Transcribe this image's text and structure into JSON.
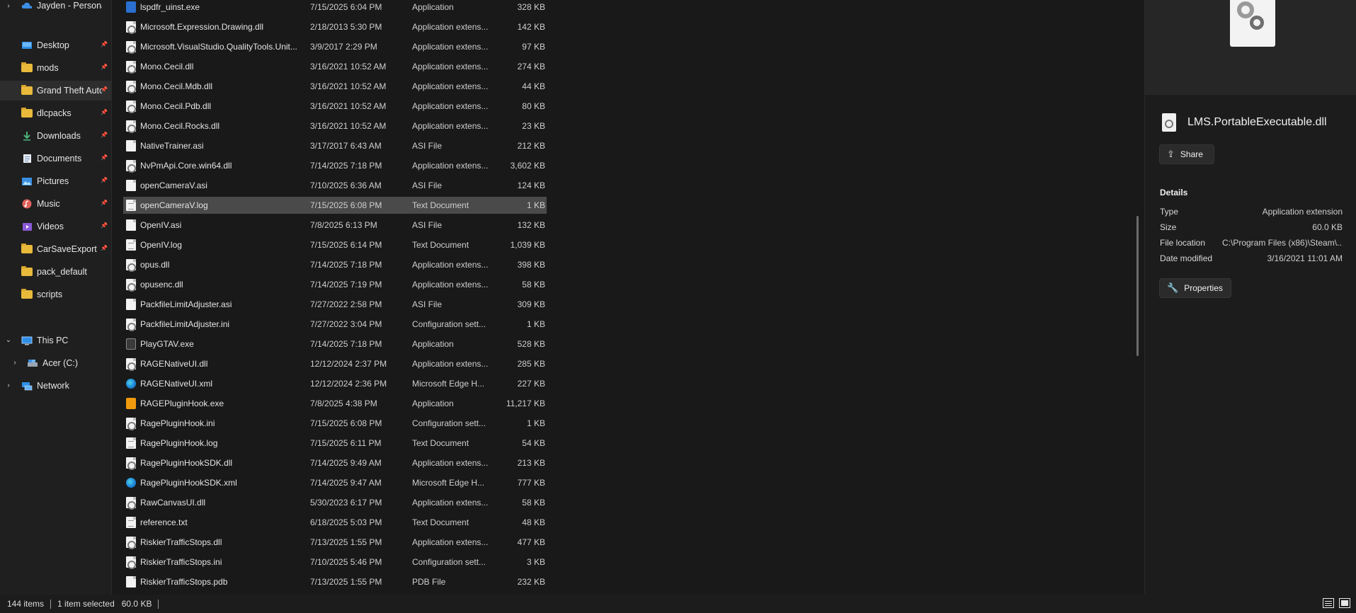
{
  "sidebar": {
    "top_partial": "Jayden - Personal",
    "quick_access": [
      {
        "label": "Desktop",
        "icon": "desktop-icon",
        "pinned": true
      },
      {
        "label": "mods",
        "icon": "folder-icon",
        "pinned": true
      },
      {
        "label": "Grand Theft Auto V",
        "icon": "folder-icon",
        "pinned": true,
        "selected": true
      },
      {
        "label": "dlcpacks",
        "icon": "folder-icon",
        "pinned": true
      },
      {
        "label": "Downloads",
        "icon": "downloads-icon",
        "pinned": true
      },
      {
        "label": "Documents",
        "icon": "documents-icon",
        "pinned": true
      },
      {
        "label": "Pictures",
        "icon": "pictures-icon",
        "pinned": true
      },
      {
        "label": "Music",
        "icon": "music-icon",
        "pinned": true
      },
      {
        "label": "Videos",
        "icon": "videos-icon",
        "pinned": true
      },
      {
        "label": "CarSaveExport",
        "icon": "folder-icon",
        "pinned": true
      },
      {
        "label": "pack_default",
        "icon": "folder-icon",
        "pinned": false
      },
      {
        "label": "scripts",
        "icon": "folder-icon",
        "pinned": false
      }
    ],
    "this_pc": "This PC",
    "drive": "Acer (C:)",
    "network": "Network"
  },
  "files": [
    {
      "name": "lspdfr_uinst.exe",
      "date": "7/15/2025 6:04 PM",
      "type": "Application",
      "size": "328 KB",
      "icon": "exe"
    },
    {
      "name": "Microsoft.Expression.Drawing.dll",
      "date": "2/18/2013 5:30 PM",
      "type": "Application extens...",
      "size": "142 KB",
      "icon": "gear"
    },
    {
      "name": "Microsoft.VisualStudio.QualityTools.Unit...",
      "date": "3/9/2017 2:29 PM",
      "type": "Application extens...",
      "size": "97 KB",
      "icon": "gear"
    },
    {
      "name": "Mono.Cecil.dll",
      "date": "3/16/2021 10:52 AM",
      "type": "Application extens...",
      "size": "274 KB",
      "icon": "gear"
    },
    {
      "name": "Mono.Cecil.Mdb.dll",
      "date": "3/16/2021 10:52 AM",
      "type": "Application extens...",
      "size": "44 KB",
      "icon": "gear"
    },
    {
      "name": "Mono.Cecil.Pdb.dll",
      "date": "3/16/2021 10:52 AM",
      "type": "Application extens...",
      "size": "80 KB",
      "icon": "gear"
    },
    {
      "name": "Mono.Cecil.Rocks.dll",
      "date": "3/16/2021 10:52 AM",
      "type": "Application extens...",
      "size": "23 KB",
      "icon": "gear"
    },
    {
      "name": "NativeTrainer.asi",
      "date": "3/17/2017 6:43 AM",
      "type": "ASI File",
      "size": "212 KB",
      "icon": "plain"
    },
    {
      "name": "NvPmApi.Core.win64.dll",
      "date": "7/14/2025 7:18 PM",
      "type": "Application extens...",
      "size": "3,602 KB",
      "icon": "gear"
    },
    {
      "name": "openCameraV.asi",
      "date": "7/10/2025 6:36 AM",
      "type": "ASI File",
      "size": "124 KB",
      "icon": "plain"
    },
    {
      "name": "openCameraV.log",
      "date": "7/15/2025 6:08 PM",
      "type": "Text Document",
      "size": "1 KB",
      "icon": "text",
      "selected": true
    },
    {
      "name": "OpenIV.asi",
      "date": "7/8/2025 6:13 PM",
      "type": "ASI File",
      "size": "132 KB",
      "icon": "plain"
    },
    {
      "name": "OpenIV.log",
      "date": "7/15/2025 6:14 PM",
      "type": "Text Document",
      "size": "1,039 KB",
      "icon": "text"
    },
    {
      "name": "opus.dll",
      "date": "7/14/2025 7:18 PM",
      "type": "Application extens...",
      "size": "398 KB",
      "icon": "gear"
    },
    {
      "name": "opusenc.dll",
      "date": "7/14/2025 7:19 PM",
      "type": "Application extens...",
      "size": "58 KB",
      "icon": "gear"
    },
    {
      "name": "PackfileLimitAdjuster.asi",
      "date": "7/27/2022 2:58 PM",
      "type": "ASI File",
      "size": "309 KB",
      "icon": "plain"
    },
    {
      "name": "PackfileLimitAdjuster.ini",
      "date": "7/27/2022 3:04 PM",
      "type": "Configuration sett...",
      "size": "1 KB",
      "icon": "gear"
    },
    {
      "name": "PlayGTAV.exe",
      "date": "7/14/2025 7:18 PM",
      "type": "Application",
      "size": "528 KB",
      "icon": "gta"
    },
    {
      "name": "RAGENativeUI.dll",
      "date": "12/12/2024 2:37 PM",
      "type": "Application extens...",
      "size": "285 KB",
      "icon": "gear"
    },
    {
      "name": "RAGENativeUI.xml",
      "date": "12/12/2024 2:36 PM",
      "type": "Microsoft Edge H...",
      "size": "227 KB",
      "icon": "edge"
    },
    {
      "name": "RAGEPluginHook.exe",
      "date": "7/8/2025 4:38 PM",
      "type": "Application",
      "size": "11,217 KB",
      "icon": "rph"
    },
    {
      "name": "RagePluginHook.ini",
      "date": "7/15/2025 6:08 PM",
      "type": "Configuration sett...",
      "size": "1 KB",
      "icon": "gear"
    },
    {
      "name": "RagePluginHook.log",
      "date": "7/15/2025 6:11 PM",
      "type": "Text Document",
      "size": "54 KB",
      "icon": "text"
    },
    {
      "name": "RagePluginHookSDK.dll",
      "date": "7/14/2025 9:49 AM",
      "type": "Application extens...",
      "size": "213 KB",
      "icon": "gear"
    },
    {
      "name": "RagePluginHookSDK.xml",
      "date": "7/14/2025 9:47 AM",
      "type": "Microsoft Edge H...",
      "size": "777 KB",
      "icon": "edge"
    },
    {
      "name": "RawCanvasUI.dll",
      "date": "5/30/2023 6:17 PM",
      "type": "Application extens...",
      "size": "58 KB",
      "icon": "gear"
    },
    {
      "name": "reference.txt",
      "date": "6/18/2025 5:03 PM",
      "type": "Text Document",
      "size": "48 KB",
      "icon": "text"
    },
    {
      "name": "RiskierTrafficStops.dll",
      "date": "7/13/2025 1:55 PM",
      "type": "Application extens...",
      "size": "477 KB",
      "icon": "gear"
    },
    {
      "name": "RiskierTrafficStops.ini",
      "date": "7/10/2025 5:46 PM",
      "type": "Configuration sett...",
      "size": "3 KB",
      "icon": "gear"
    },
    {
      "name": "RiskierTrafficStops.pdb",
      "date": "7/13/2025 1:55 PM",
      "type": "PDB File",
      "size": "232 KB",
      "icon": "plain"
    }
  ],
  "details": {
    "file_name": "LMS.PortableExecutable.dll",
    "share_label": "Share",
    "heading": "Details",
    "props": [
      {
        "key": "Type",
        "value": "Application extension"
      },
      {
        "key": "Size",
        "value": "60.0 KB"
      },
      {
        "key": "File location",
        "value": "C:\\Program Files (x86)\\Steam\\..."
      },
      {
        "key": "Date modified",
        "value": "3/16/2021 11:01 AM"
      }
    ],
    "properties_label": "Properties"
  },
  "status": {
    "item_count": "144 items",
    "selection": "1 item selected",
    "selection_size": "60.0 KB"
  }
}
